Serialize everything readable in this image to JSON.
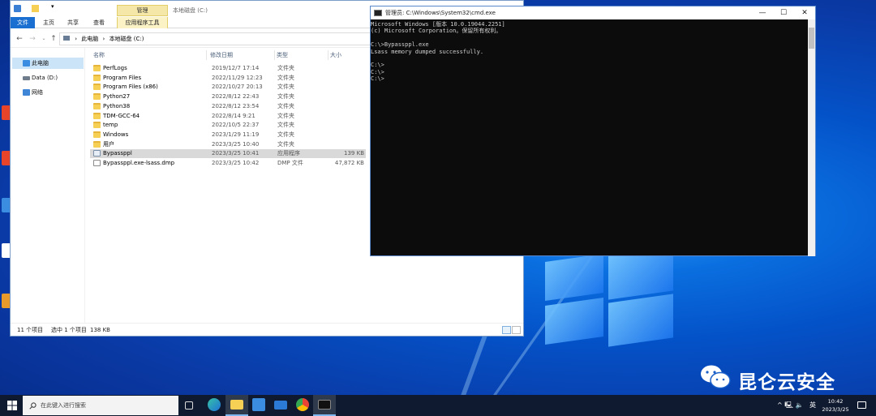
{
  "explorer": {
    "quick_access_arrow": "▾",
    "context_tab": "管理",
    "ribbon_tabs": [
      "文件",
      "主页",
      "共享",
      "查看",
      "应用程序工具"
    ],
    "ribbon_title": "本地磁盘 (C:)",
    "address": {
      "this_pc": "此电脑",
      "separator": "›",
      "drive": "本地磁盘 (C:)"
    },
    "nav": [
      "此电脑",
      "Data (D:)",
      "网络"
    ],
    "columns": [
      "名称",
      "修改日期",
      "类型",
      "大小"
    ],
    "files": [
      {
        "name": "PerfLogs",
        "date": "2019/12/7 17:14",
        "type": "文件夹",
        "size": "",
        "icon": "folder"
      },
      {
        "name": "Program Files",
        "date": "2022/11/29 12:23",
        "type": "文件夹",
        "size": "",
        "icon": "folder"
      },
      {
        "name": "Program Files (x86)",
        "date": "2022/10/27 20:13",
        "type": "文件夹",
        "size": "",
        "icon": "folder"
      },
      {
        "name": "Python27",
        "date": "2022/8/12 22:43",
        "type": "文件夹",
        "size": "",
        "icon": "folder"
      },
      {
        "name": "Python38",
        "date": "2022/8/12 23:54",
        "type": "文件夹",
        "size": "",
        "icon": "folder"
      },
      {
        "name": "TDM-GCC-64",
        "date": "2022/8/14 9:21",
        "type": "文件夹",
        "size": "",
        "icon": "folder"
      },
      {
        "name": "temp",
        "date": "2022/10/5 22:37",
        "type": "文件夹",
        "size": "",
        "icon": "folder"
      },
      {
        "name": "Windows",
        "date": "2023/1/29 11:19",
        "type": "文件夹",
        "size": "",
        "icon": "folder"
      },
      {
        "name": "用户",
        "date": "2023/3/25 10:40",
        "type": "文件夹",
        "size": "",
        "icon": "folder"
      },
      {
        "name": "Bypassppl",
        "date": "2023/3/25 10:41",
        "type": "应用程序",
        "size": "139 KB",
        "icon": "exe"
      },
      {
        "name": "Bypassppl.exe-lsass.dmp",
        "date": "2023/3/25 10:42",
        "type": "DMP 文件",
        "size": "47,872 KB",
        "icon": "dmp"
      }
    ],
    "status": {
      "count": "11 个项目",
      "selected": "选中 1 个项目",
      "selected_size": "138 KB"
    }
  },
  "cmd": {
    "title": "管理员: C:\\Windows\\System32\\cmd.exe",
    "lines": [
      "Microsoft Windows [版本 10.0.19044.2251]",
      "(c) Microsoft Corporation。保留所有权利。",
      "",
      "C:\\>Bypassppl.exe",
      "Lsass memory dumped successfully.",
      "",
      "C:\\>",
      "C:\\>",
      "C:\\>"
    ],
    "buttons": {
      "minimize": "—",
      "maximize": "☐",
      "close": "✕"
    }
  },
  "watermark": {
    "text": "昆仑云安全"
  },
  "taskbar": {
    "search_placeholder": "在此键入进行搜索",
    "tray": {
      "icons": "^ 🖳 🔈",
      "lang": "英",
      "time": "10:42",
      "date": "2023/3/25"
    }
  },
  "colors": {
    "accent": "#1a6fd0",
    "selection": "#cce4f7",
    "taskbar": "#0f1a30",
    "cmd_bg": "#0c0c0c"
  }
}
